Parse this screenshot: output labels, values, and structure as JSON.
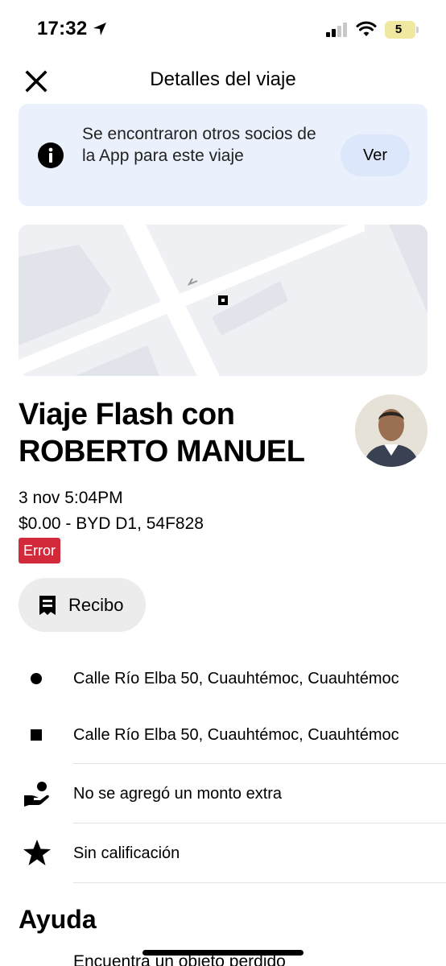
{
  "status_bar": {
    "time": "17:32",
    "battery_level": "5",
    "battery_color": "#f0e7a1"
  },
  "header": {
    "title": "Detalles del viaje",
    "close_icon": "close-icon"
  },
  "banner": {
    "text": "Se encontraron otros socios de la App para este viaje",
    "button_label": "Ver",
    "icon": "info-icon",
    "background": "#eaf0fc"
  },
  "trip": {
    "title": "Viaje Flash con ROBERTO MANUEL",
    "date": "3 nov 5:04PM",
    "fare": "$0.00 - BYD D1, 54F828",
    "status": "Error",
    "status_color": "#d2293b",
    "receipt_label": "Recibo"
  },
  "route": {
    "pickup": "Calle Río Elba 50, Cuauhtémoc, Cuauhtémoc",
    "dropoff": "Calle Río Elba 50, Cuauhtémoc, Cuauhtémoc"
  },
  "extras": {
    "tip": "No se agregó un monto extra",
    "rating": "Sin calificación"
  },
  "help": {
    "title": "Ayuda",
    "items": [
      "Encuentra un objeto perdido"
    ]
  }
}
